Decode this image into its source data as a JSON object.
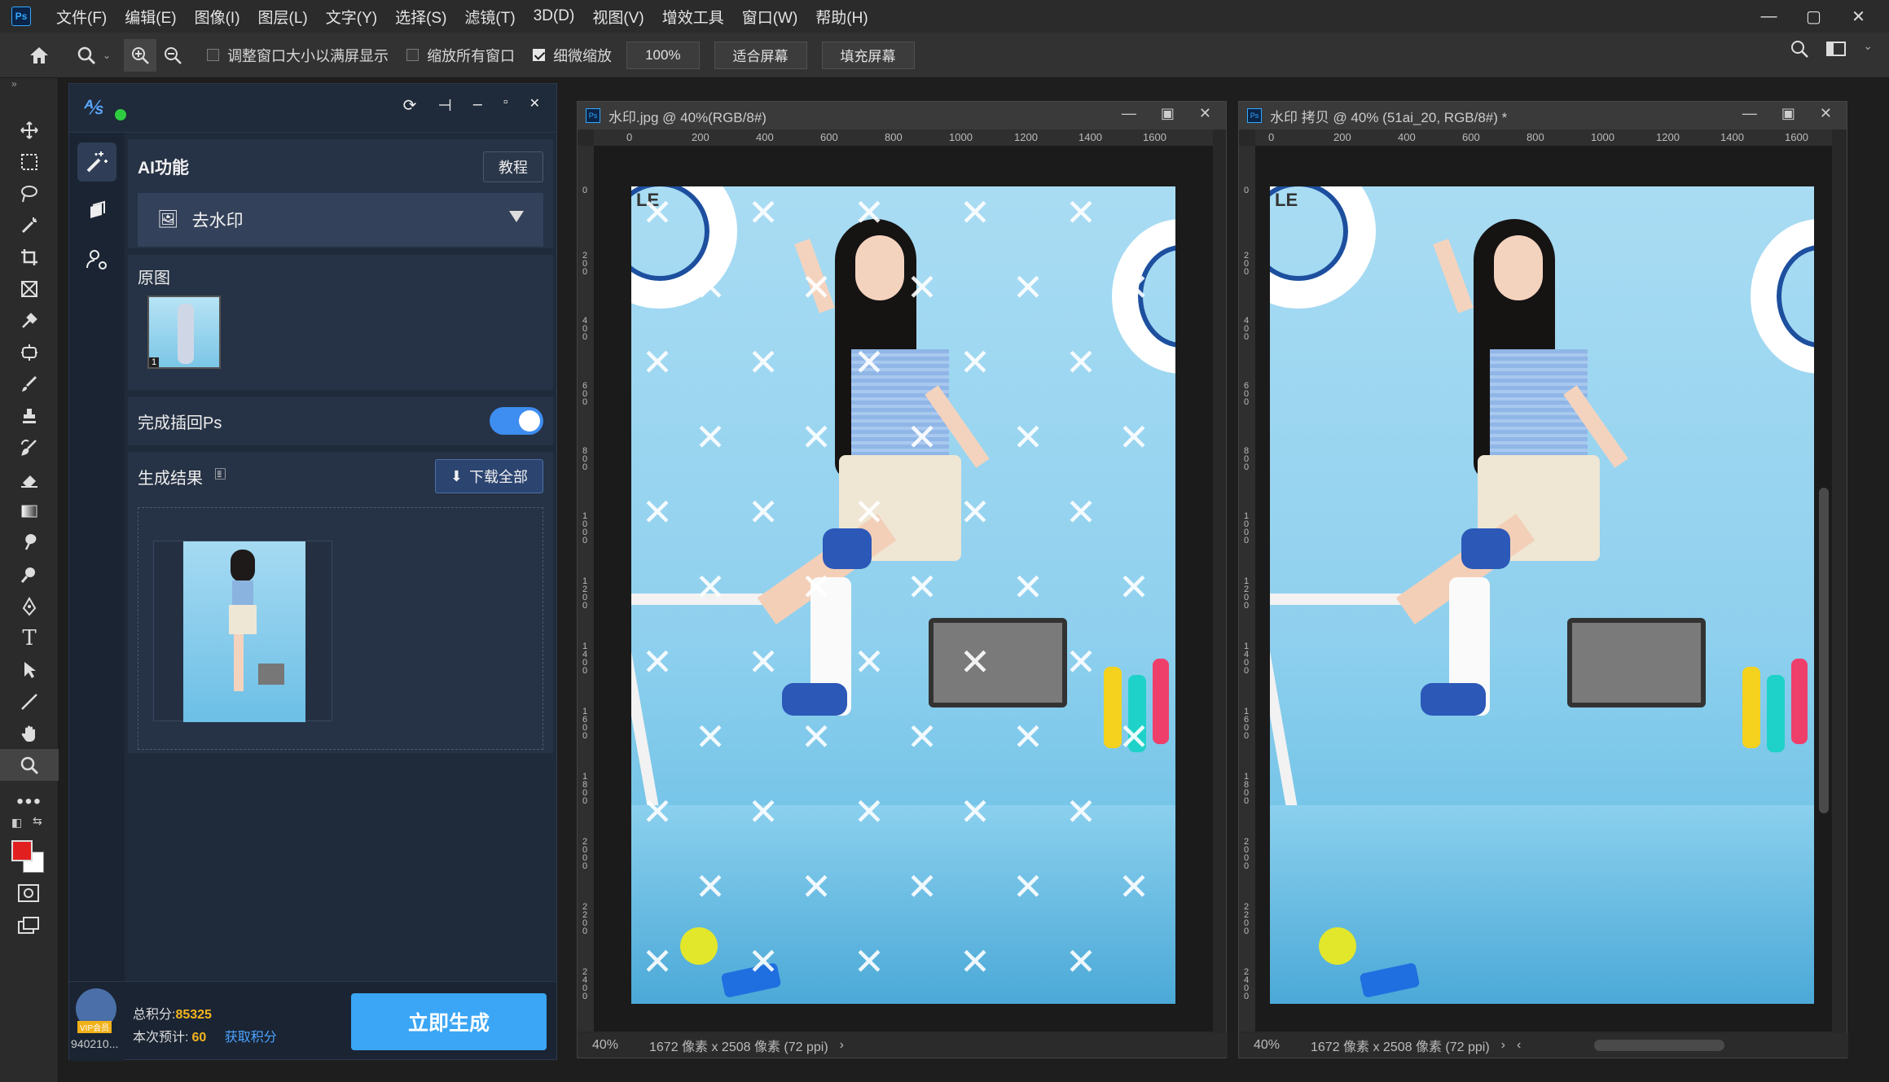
{
  "app": {
    "logo": "Ps"
  },
  "menu": [
    "文件(F)",
    "编辑(E)",
    "图像(I)",
    "图层(L)",
    "文字(Y)",
    "选择(S)",
    "滤镜(T)",
    "3D(D)",
    "视图(V)",
    "增效工具",
    "窗口(W)",
    "帮助(H)"
  ],
  "options": {
    "resize_windows": "调整窗口大小以满屏显示",
    "zoom_all": "缩放所有窗口",
    "scrubby_zoom": "细微缩放",
    "zoom_value": "100%",
    "fit_screen": "适合屏幕",
    "fill_screen": "填充屏幕"
  },
  "plugin": {
    "ai_title": "AI功能",
    "tutorial": "教程",
    "feature": "去水印",
    "original_label": "原图",
    "thumb_badge": "1",
    "insert_label": "完成插回Ps",
    "result_label": "生成结果",
    "download_all": "下载全部",
    "points_label": "总积分:",
    "points_value": "85325",
    "estimate_label": "本次预计:",
    "estimate_value": "60",
    "get_points": "获取积分",
    "user_id": "940210...",
    "vip": "VIP会员",
    "generate": "立即生成"
  },
  "doc1": {
    "title": "水印.jpg @ 40%(RGB/8#)",
    "ruler_h": [
      "0",
      "200",
      "400",
      "600",
      "800",
      "1000",
      "1200",
      "1400",
      "1600"
    ],
    "ruler_v": [
      "0",
      "200",
      "400",
      "600",
      "800",
      "1000",
      "1200",
      "1400",
      "1600",
      "1800",
      "2000",
      "2200",
      "2400"
    ],
    "zoom": "40%",
    "info": "1672 像素 x 2508 像素 (72 ppi)",
    "photo_text": [
      "LE",
      "CI"
    ]
  },
  "doc2": {
    "title": "水印 拷贝 @ 40% (51ai_20, RGB/8#) *",
    "ruler_h": [
      "0",
      "200",
      "400",
      "600",
      "800",
      "1000",
      "1200",
      "1400",
      "1600"
    ],
    "ruler_v": [
      "0",
      "200",
      "400",
      "600",
      "800",
      "1000",
      "1200",
      "1400",
      "1600",
      "1800",
      "2000",
      "2200",
      "2400"
    ],
    "zoom": "40%",
    "info": "1672 像素 x 2508 像素 (72 ppi)",
    "photo_text": [
      "LE",
      "CI"
    ]
  }
}
